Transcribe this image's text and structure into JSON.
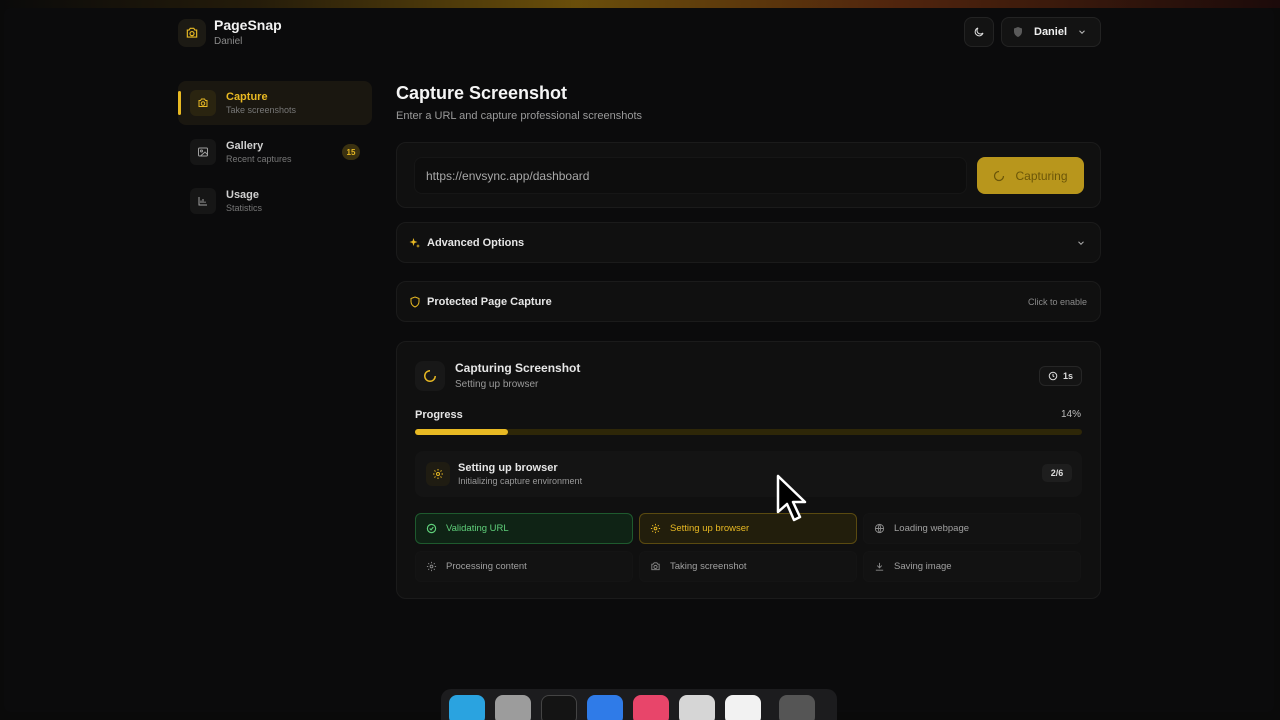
{
  "app": {
    "name": "PageSnap",
    "user": "Daniel"
  },
  "header": {
    "user_label": "Daniel"
  },
  "sidebar": {
    "items": [
      {
        "title": "Capture",
        "subtitle": "Take screenshots"
      },
      {
        "title": "Gallery",
        "subtitle": "Recent captures",
        "badge": "15"
      },
      {
        "title": "Usage",
        "subtitle": "Statistics"
      }
    ]
  },
  "main": {
    "title": "Capture Screenshot",
    "subtitle": "Enter a URL and capture professional screenshots",
    "url_value": "https://envsync.app/dashboard",
    "capture_label": "Capturing",
    "advanced_label": "Advanced Options",
    "protected_label": "Protected Page Capture",
    "protected_hint": "Click to enable"
  },
  "status": {
    "title": "Capturing Screenshot",
    "subtitle": "Setting up browser",
    "timer": "1s",
    "progress_label": "Progress",
    "progress_text": "14%",
    "progress_value": 0.14,
    "current_step_title": "Setting up browser",
    "current_step_desc": "Initializing capture environment",
    "step_count": "2/6",
    "steps": [
      {
        "label": "Validating URL",
        "state": "done"
      },
      {
        "label": "Setting up browser",
        "state": "active"
      },
      {
        "label": "Loading webpage",
        "state": "pending"
      },
      {
        "label": "Processing content",
        "state": "pending"
      },
      {
        "label": "Taking screenshot",
        "state": "pending"
      },
      {
        "label": "Saving image",
        "state": "pending"
      }
    ]
  },
  "colors": {
    "accent": "#e8b923",
    "success": "#5fcf7a",
    "background": "#0b0b0c"
  }
}
